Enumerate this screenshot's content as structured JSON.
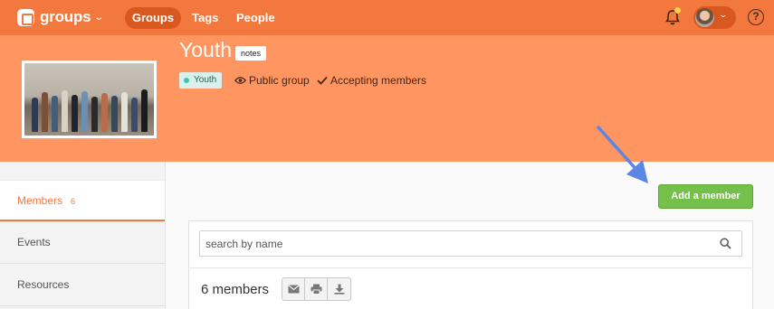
{
  "nav": {
    "brand": "groups",
    "items": [
      {
        "label": "Groups",
        "active": true
      },
      {
        "label": "Tags",
        "active": false
      },
      {
        "label": "People",
        "active": false
      }
    ],
    "help_label": "?"
  },
  "group": {
    "title": "Youth",
    "notes_label": "notes",
    "tag": "Youth",
    "visibility": "Public group",
    "status": "Accepting members"
  },
  "sidebar": {
    "items": [
      {
        "label": "Members",
        "count": "6",
        "active": true
      },
      {
        "label": "Events"
      },
      {
        "label": "Resources"
      }
    ]
  },
  "members": {
    "add_button": "Add a member",
    "search_placeholder": "search by name",
    "count_label": "6 members"
  },
  "colors": {
    "nav_bg": "#f2783e",
    "header_bg": "#ff9561",
    "accent": "#f2783e",
    "add_button": "#74c04a",
    "annotation_arrow": "#5b86e5"
  },
  "icons": [
    "groups-logo-icon",
    "chevron-down-icon",
    "bell-icon",
    "avatar",
    "help-icon",
    "eye-icon",
    "check-icon",
    "search-icon",
    "email-icon",
    "print-icon",
    "download-icon"
  ]
}
